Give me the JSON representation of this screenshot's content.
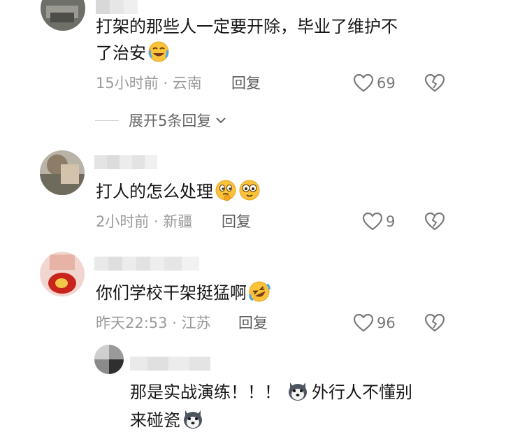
{
  "comments": [
    {
      "text_line1": "打架的那些人一定要开除，毕业了维护不",
      "text_line2": "了治安",
      "emoji": "crying-laughing-emoji",
      "time": "15小时前",
      "location": "云南",
      "reply_label": "回复",
      "likes": "69",
      "expand_label": "展开5条回复"
    },
    {
      "text_line1": "打人的怎么处理",
      "emoji": "thinking-and-wide-eyes-emoji",
      "time": "2小时前",
      "location": "新疆",
      "reply_label": "回复",
      "likes": "9"
    },
    {
      "text_line1": "你们学校干架挺猛啊",
      "emoji": "rolling-laughing-emoji",
      "time": "昨天22:53",
      "location": "江苏",
      "reply_label": "回复",
      "likes": "96"
    },
    {
      "text_line1_a": "那是实战演练！！！",
      "text_line1_b": "外行人不懂别",
      "text_line2": "来碰瓷",
      "emoji": "husky-dog-emoji"
    }
  ],
  "separator": " · ",
  "colors": {
    "meta": "#9a9a9a",
    "text": "#161616",
    "icon": "#7a7a7a"
  }
}
